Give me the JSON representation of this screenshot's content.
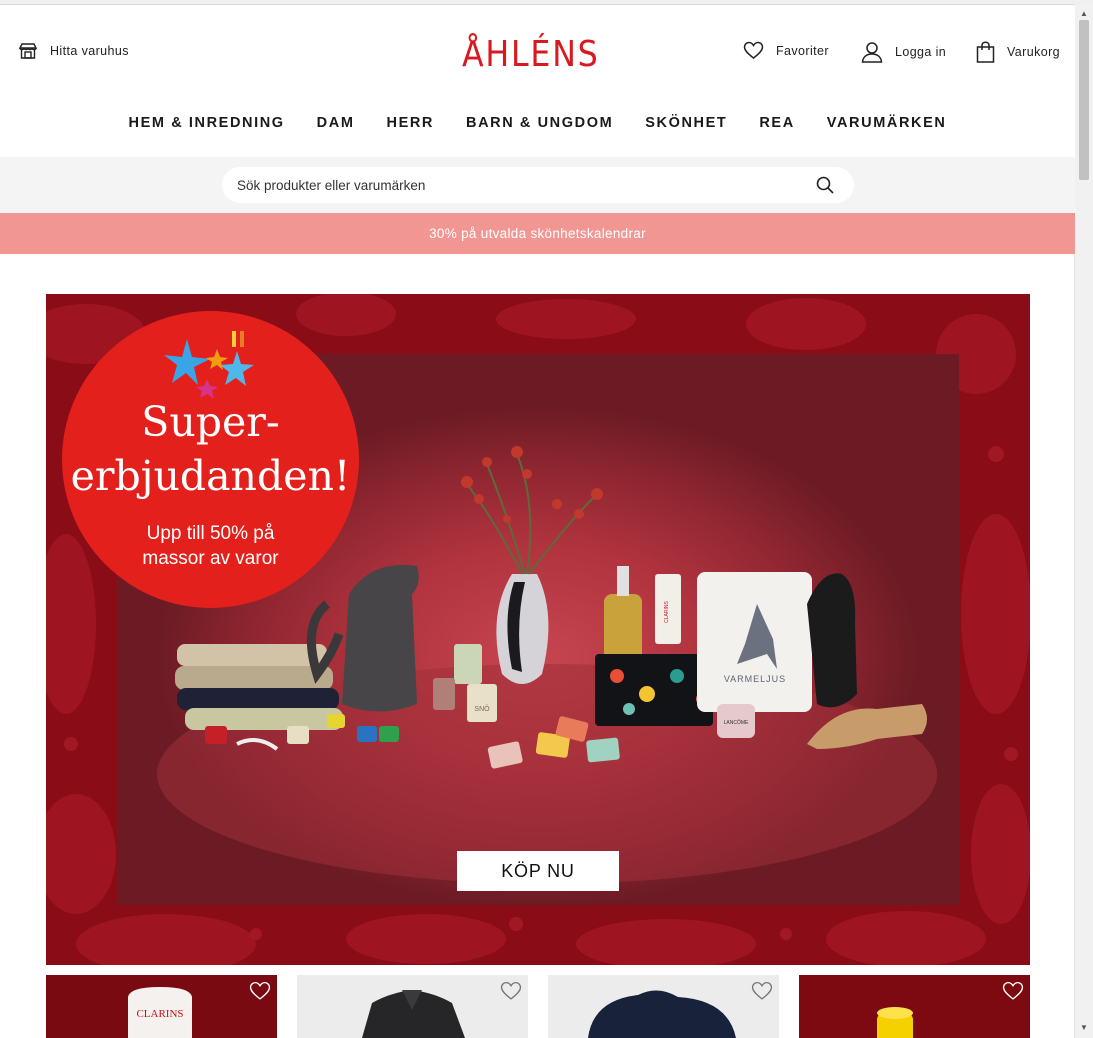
{
  "header": {
    "find_store_label": "Hitta varuhus",
    "logo_text": "ÅHLÉNS",
    "favorites_label": "Favoriter",
    "login_label": "Logga in",
    "cart_label": "Varukorg"
  },
  "nav": {
    "items": [
      "HEM & INREDNING",
      "DAM",
      "HERR",
      "BARN & UNGDOM",
      "SKÖNHET",
      "REA",
      "VARUMÄRKEN"
    ]
  },
  "search": {
    "placeholder": "Sök produkter eller varumärken"
  },
  "promo": {
    "text": "30% på utvalda skönhetskalendrar",
    "color": "#f19692"
  },
  "hero": {
    "title_line1": "Super-",
    "title_line2": "erbjudanden!",
    "subtitle_line1": "Upp till 50% på",
    "subtitle_line2": "massor av varor",
    "button_label": "KÖP NU",
    "product_labels": {
      "tin": "VARMELJUS",
      "candle": "SNÖ",
      "jar": "LANCÔME",
      "tube": "CLARINS"
    },
    "colors": {
      "background": "#8a0c16",
      "circle": "#e3201b"
    }
  },
  "cards": [
    {
      "brand_text": "CLARINS",
      "favorite_icon": "heart-icon"
    },
    {
      "favorite_icon": "heart-icon"
    },
    {
      "favorite_icon": "heart-icon"
    },
    {
      "favorite_icon": "heart-icon"
    }
  ],
  "colors": {
    "brand": "#d71920",
    "promo": "#f19692"
  }
}
